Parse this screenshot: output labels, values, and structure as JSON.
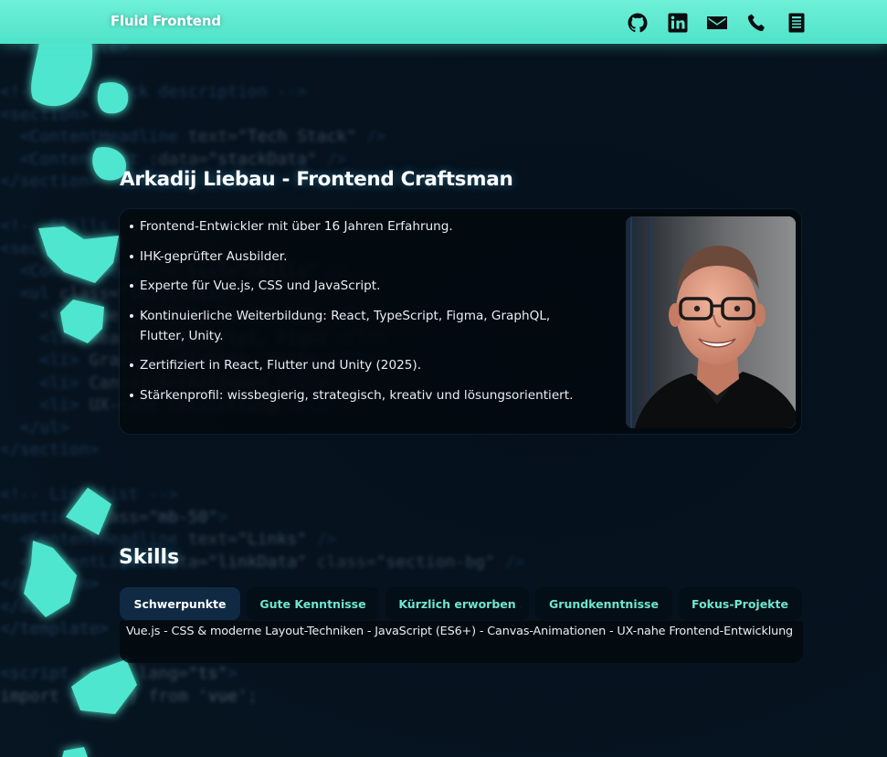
{
  "header": {
    "brand": "Fluid Frontend",
    "links": [
      {
        "icon": "github-icon",
        "label": "GitHub"
      },
      {
        "icon": "linkedin-icon",
        "label": "LinkedIn"
      },
      {
        "icon": "mail-icon",
        "label": "E-Mail"
      },
      {
        "icon": "phone-icon",
        "label": "Telefon"
      },
      {
        "icon": "document-icon",
        "label": "Lebenslauf"
      }
    ]
  },
  "about": {
    "title": "Arkadij Liebau - Frontend Craftsman",
    "bullets": [
      "Frontend-Entwickler mit über 16 Jahren Erfahrung.",
      "IHK-geprüfter Ausbilder.",
      "Experte für Vue.js, CSS und JavaScript.",
      "Kontinuierliche Weiterbildung: React, TypeScript, Figma, GraphQL, Flutter, Unity.",
      "Zertifiziert in React, Flutter und Unity (2025).",
      "Stärkenprofil: wissbegierig, strategisch, kreativ und lösungsorientiert."
    ]
  },
  "skills": {
    "title": "Skills",
    "tabs": [
      "Schwerpunkte",
      "Gute Kenntnisse",
      "Kürzlich erworben",
      "Grundkenntnisse",
      "Fokus-Projekte"
    ],
    "active_tab": "Schwerpunkte",
    "content": "Vue.js - CSS & moderne Layout-Techniken - JavaScript (ES6+) - Canvas-Animationen - UX-nahe Frontend-Entwicklung"
  },
  "colors": {
    "header": "#5fe9d0",
    "accent": "#6fe6cf",
    "blob": "#4fe6cf",
    "background": "#071522"
  }
}
